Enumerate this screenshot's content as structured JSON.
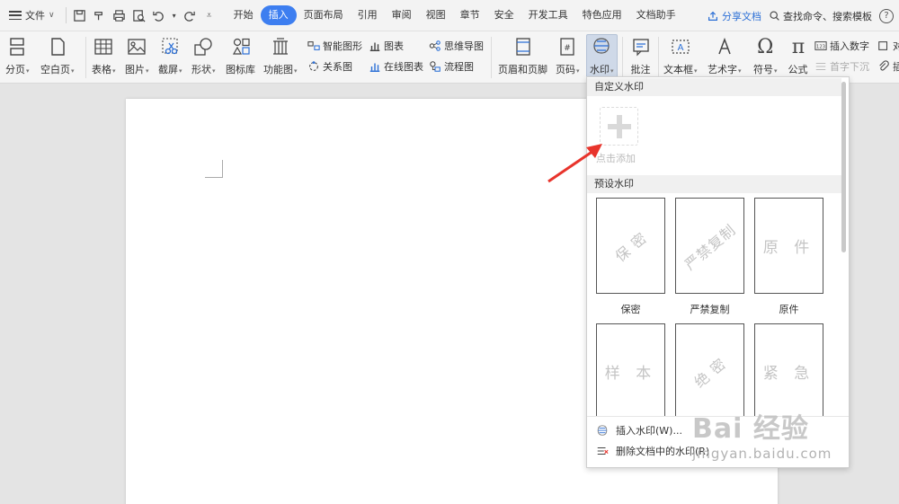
{
  "menubar": {
    "file_label": "文件",
    "tabs": [
      {
        "label": "开始",
        "active": false
      },
      {
        "label": "插入",
        "active": true
      },
      {
        "label": "页面布局",
        "active": false
      },
      {
        "label": "引用",
        "active": false
      },
      {
        "label": "审阅",
        "active": false
      },
      {
        "label": "视图",
        "active": false
      },
      {
        "label": "章节",
        "active": false
      },
      {
        "label": "安全",
        "active": false
      },
      {
        "label": "开发工具",
        "active": false
      },
      {
        "label": "特色应用",
        "active": false
      },
      {
        "label": "文档助手",
        "active": false
      }
    ],
    "share_label": "分享文档",
    "search_label": "查找命令、搜索模板",
    "help_label": "?"
  },
  "ribbon": {
    "page_break": "分页",
    "blank_page": "空白页",
    "table": "表格",
    "picture": "图片",
    "screenshot": "截屏",
    "shape": "形状",
    "icon_lib": "图标库",
    "func_chart": "功能图",
    "smart_art": "智能图形",
    "chart": "图表",
    "mind_map": "思维导图",
    "relation": "关系图",
    "online_chart": "在线图表",
    "flow_chart": "流程图",
    "header_footer": "页眉和页脚",
    "page_number": "页码",
    "watermark": "水印",
    "comment": "批注",
    "text_box": "文本框",
    "word_art": "艺术字",
    "symbol": "符号",
    "formula": "公式",
    "insert_number": "插入数字",
    "drop_cap": "首字下沉",
    "object_partial": "对",
    "attach_partial": "插"
  },
  "watermark_menu": {
    "custom_header": "自定义水印",
    "add_label": "点击添加",
    "preset_header": "预设水印",
    "presets": [
      {
        "text": "保 密",
        "caption": "保密",
        "rotated": true
      },
      {
        "text": "严禁复制",
        "caption": "严禁复制",
        "rotated": true
      },
      {
        "text": "原 件",
        "caption": "原件",
        "rotated": false
      },
      {
        "text": "样 本",
        "caption": "",
        "rotated": false
      },
      {
        "text": "绝 密",
        "caption": "",
        "rotated": true
      },
      {
        "text": "紧 急",
        "caption": "",
        "rotated": false
      }
    ],
    "insert_item": "插入水印(W)...",
    "delete_item": "删除文档中的水印(R)"
  },
  "logo": {
    "text": "Bai 经验",
    "sub": "jingyan.baidu.com"
  },
  "colors": {
    "accent": "#3d7ef0",
    "annotation": "#e8342c"
  }
}
